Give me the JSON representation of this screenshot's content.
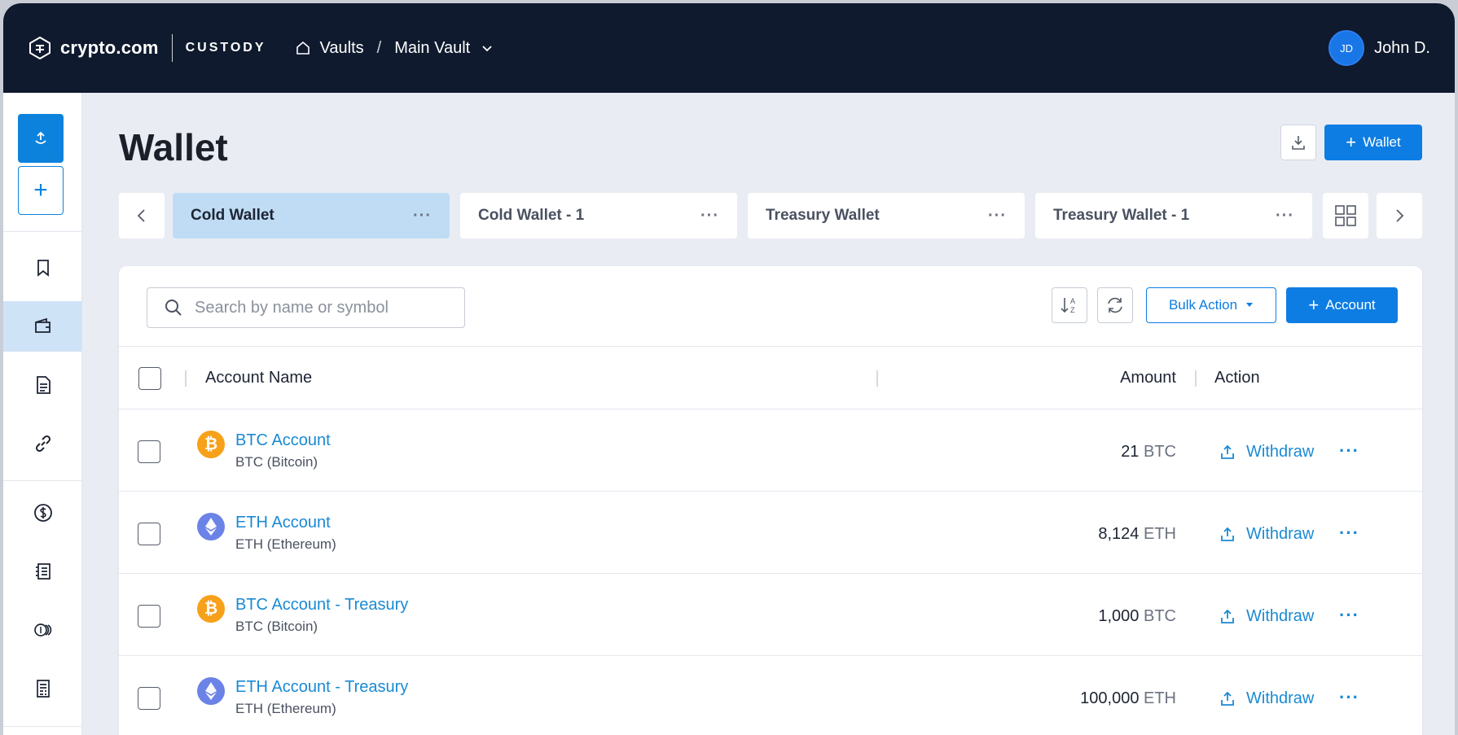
{
  "header": {
    "logo_text": "crypto.com",
    "logo_sub": "CUSTODY",
    "breadcrumb_root": "Vaults",
    "breadcrumb_separator": "/",
    "breadcrumb_current": "Main Vault",
    "user_initials": "JD",
    "user_name": "John D."
  },
  "page": {
    "title": "Wallet",
    "add_wallet_label": "Wallet",
    "add_account_label": "Account",
    "bulk_action_label": "Bulk Action"
  },
  "tabs": [
    {
      "label": "Cold Wallet",
      "active": true
    },
    {
      "label": "Cold Wallet - 1",
      "active": false
    },
    {
      "label": "Treasury Wallet",
      "active": false
    },
    {
      "label": "Treasury Wallet - 1",
      "active": false
    }
  ],
  "tab_menu_glyph": "···",
  "search": {
    "placeholder": "Search by name or symbol"
  },
  "table": {
    "headers": {
      "account_name": "Account Name",
      "amount": "Amount",
      "action": "Action"
    },
    "action_label": "Withdraw",
    "row_menu_glyph": "···",
    "rows": [
      {
        "name": "BTC Account",
        "sub": "BTC (Bitcoin)",
        "amount": "21",
        "unit": "BTC",
        "coin": "btc"
      },
      {
        "name": "ETH Account",
        "sub": "ETH (Ethereum)",
        "amount": "8,124",
        "unit": "ETH",
        "coin": "eth"
      },
      {
        "name": "BTC Account - Treasury",
        "sub": "BTC (Bitcoin)",
        "amount": "1,000",
        "unit": "BTC",
        "coin": "btc"
      },
      {
        "name": "ETH Account - Treasury",
        "sub": "ETH (Ethereum)",
        "amount": "100,000",
        "unit": "ETH",
        "coin": "eth"
      }
    ]
  },
  "colors": {
    "topbar": "#0f1a2e",
    "primary": "#0d7de3",
    "link": "#1a8ad3",
    "btc": "#f7a11a",
    "eth": "#6b83e6",
    "active_tab": "#bfdcf4"
  }
}
